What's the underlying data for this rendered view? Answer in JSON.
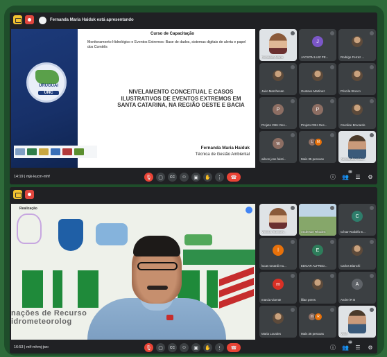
{
  "panel1": {
    "presenter_notice": "Fernanda Maria Haiduk está apresentando",
    "meet_code": "14:19  |  mjk-kucm-mhf",
    "slide": {
      "course": "Curso de Capacitação",
      "subtitle": "Monitoramento Hidrológico e Eventos Extremos: Base de dados, sistemas digitais de alerta e papel dos Comitês",
      "logo_text": "URUGUAI",
      "logo_badge": "UNC",
      "main_title": "NIVELAMENTO CONCEITUAL E CASOS ILUSTRATIVOS DE EVENTOS EXTREMOS EM SANTA CATARINA, NA REGIÃO OESTE E BACIA",
      "author": "Fernanda Maria Haiduk",
      "role": "Técnica de Gestão Ambiental"
    },
    "participants": [
      {
        "name": "Fernanda Maria",
        "kind": "video"
      },
      {
        "name": "JACSON LUIZ PE...",
        "initial": "J",
        "color": "#7b57c8"
      },
      {
        "name": "Rodrigo Ferraz ...",
        "kind": "photo"
      },
      {
        "name": "Jairo Marchesan",
        "kind": "photo"
      },
      {
        "name": "Gustavo Martinez",
        "kind": "photo"
      },
      {
        "name": "Priscila Stocco",
        "kind": "photo"
      },
      {
        "name": "Projeto CBH Oes...",
        "initial": "P",
        "color": "#8d6e63"
      },
      {
        "name": "Projeto CBH Oes...",
        "initial": "P",
        "color": "#8d6e63"
      },
      {
        "name": "Caroline Brocardo",
        "kind": "photo"
      },
      {
        "name": "wilson jose faisti...",
        "initial": "w",
        "color": "#8d6e63"
      },
      {
        "name": "Mais 35 pessoas",
        "kind": "group",
        "g1": "L",
        "g2": "M"
      },
      {
        "name": "Alessandra Kiaw...",
        "kind": "video2"
      }
    ],
    "people_count": "36"
  },
  "panel2": {
    "meet_code": "16:53  |  mif-mhmj-jwo",
    "background": {
      "realization": "Realização",
      "bottom_text": "nações de Recurso\nidrometeorolog"
    },
    "participants": [
      {
        "name": "Vinicius Sumariv...",
        "kind": "video"
      },
      {
        "name": "Anderson Rhoden",
        "kind": "outdoor"
      },
      {
        "name": "César Rodolfo E...",
        "initial": "C",
        "color": "#2e7d6b"
      },
      {
        "name": "lucas tonardi mu...",
        "initial": "l",
        "color": "#e8710a"
      },
      {
        "name": "EDGAR ALFRED...",
        "initial": "E",
        "color": "#2e7d5b"
      },
      {
        "name": "Carlos Bianchi",
        "kind": "photo"
      },
      {
        "name": "marcia vicente",
        "initial": "m",
        "color": "#d93025"
      },
      {
        "name": "lilian peres",
        "kind": "photo"
      },
      {
        "name": "Andrei R B",
        "initial": "A",
        "color": "#5f6368"
      },
      {
        "name": "Maria Lourdes",
        "kind": "photo"
      },
      {
        "name": "Mais 36 pessoas",
        "kind": "group",
        "g1": "m",
        "g2": "R"
      },
      {
        "name": "Você",
        "kind": "video2"
      }
    ],
    "people_count": "48"
  },
  "controls": {
    "mic": "🎙",
    "cam": "▢",
    "captions": "cc",
    "emoji": "☺",
    "present": "▣",
    "raise": "✋",
    "more": "⋮",
    "end": "☎",
    "info": "ⓘ",
    "people": "👥",
    "chat": "☰",
    "activities": "⚙"
  },
  "colors": {
    "frame_green": "#1e4d2a",
    "meet_dark": "#202124",
    "end_red": "#ea4335"
  }
}
